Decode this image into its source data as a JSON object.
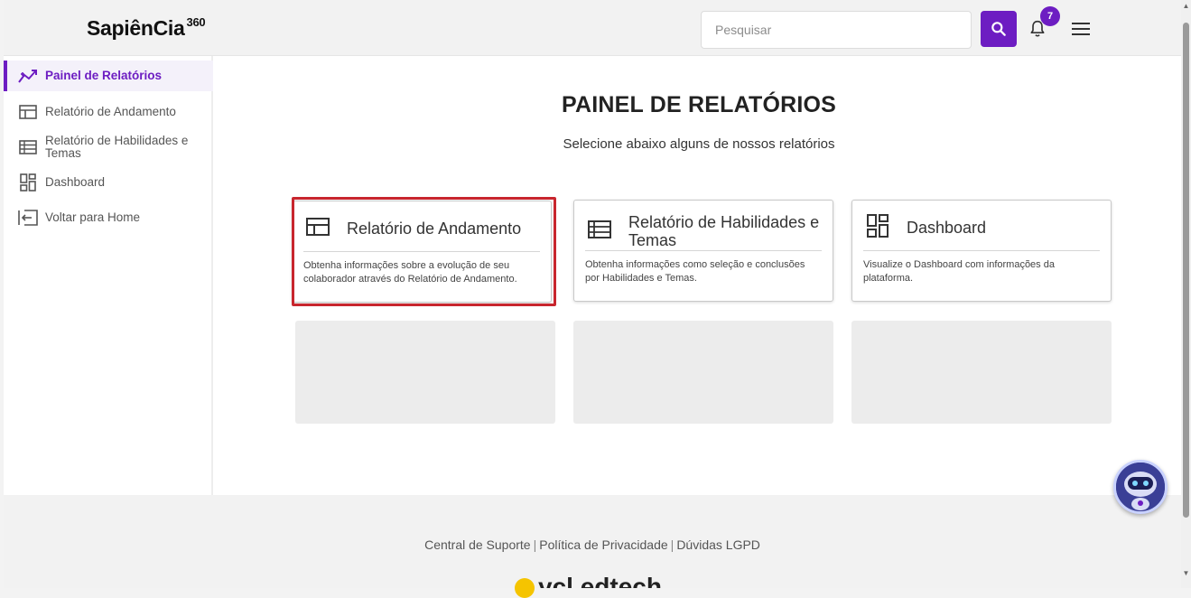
{
  "header": {
    "logo_text": "SapiênCia",
    "logo_sup": "360",
    "search_placeholder": "Pesquisar",
    "notification_count": "7"
  },
  "sidebar": {
    "items": [
      {
        "label": "Painel de Relatórios",
        "icon": "trend-chart-icon",
        "active": true
      },
      {
        "label": "Relatório de Andamento",
        "icon": "layout-table-icon"
      },
      {
        "label": "Relatório de Habilidades e Temas",
        "icon": "list-table-icon"
      },
      {
        "label": "Dashboard",
        "icon": "dashboard-icon"
      },
      {
        "label": "Voltar para Home",
        "icon": "exit-icon"
      }
    ]
  },
  "main": {
    "title": "PAINEL DE RELATÓRIOS",
    "subtitle": "Selecione abaixo alguns de nossos relatórios",
    "cards": [
      {
        "title": "Relatório de Andamento",
        "description": "Obtenha informações sobre a evolução de seu colaborador através do Relatório de Andamento.",
        "icon": "layout-table-icon"
      },
      {
        "title": "Relatório de Habilidades e Temas",
        "description": "Obtenha informações como seleção e conclusões por Habilidades e Temas.",
        "icon": "list-table-icon"
      },
      {
        "title": "Dashboard",
        "description": "Visualize o Dashboard com informações da plataforma.",
        "icon": "dashboard-icon"
      }
    ]
  },
  "footer": {
    "links": [
      "Central de Suporte",
      "Política de Privacidade",
      "Dúvidas LGPD"
    ],
    "separator": "|",
    "brand_partial": "ycl edtech"
  },
  "colors": {
    "accent": "#6d1dc2",
    "highlight": "#c8262e"
  }
}
